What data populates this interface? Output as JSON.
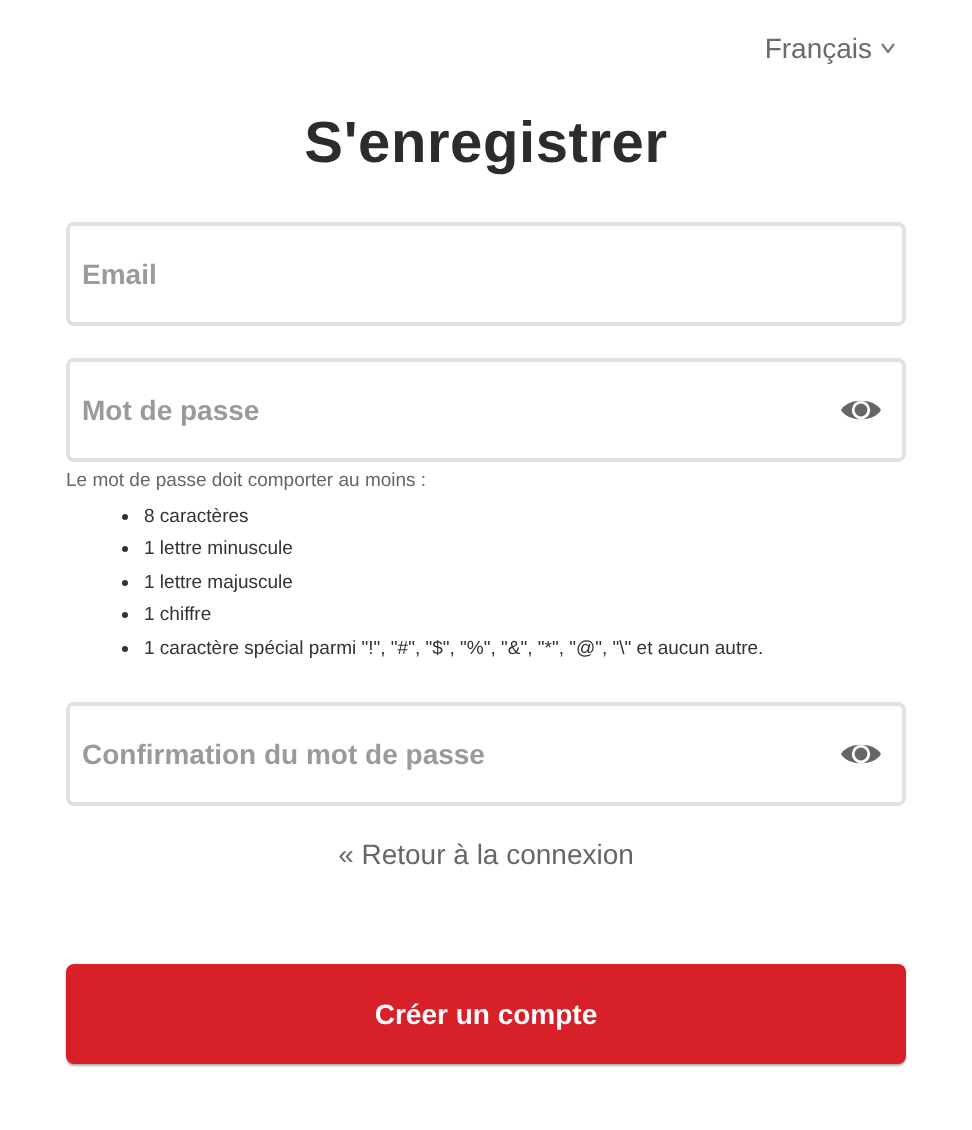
{
  "language": {
    "label": "Français"
  },
  "title": "S'enregistrer",
  "fields": [
    {
      "kind": "email",
      "placeholder": "Email"
    },
    {
      "kind": "password",
      "placeholder": "Mot de passe",
      "hint": {
        "intro": "Le mot de passe doit comporter au moins :",
        "rules": [
          "8 caractères",
          "1 lettre minuscule",
          "1 lettre majuscule",
          "1 chiffre",
          "1 caractère spécial parmi \"!\", \"#\", \"$\", \"%\", \"&\", \"*\", \"@\", \"\\\" et aucun autre."
        ]
      }
    },
    {
      "kind": "password",
      "placeholder": "Confirmation du mot de passe"
    }
  ],
  "back_link": "« Retour à la connexion",
  "submit": "Créer un compte"
}
